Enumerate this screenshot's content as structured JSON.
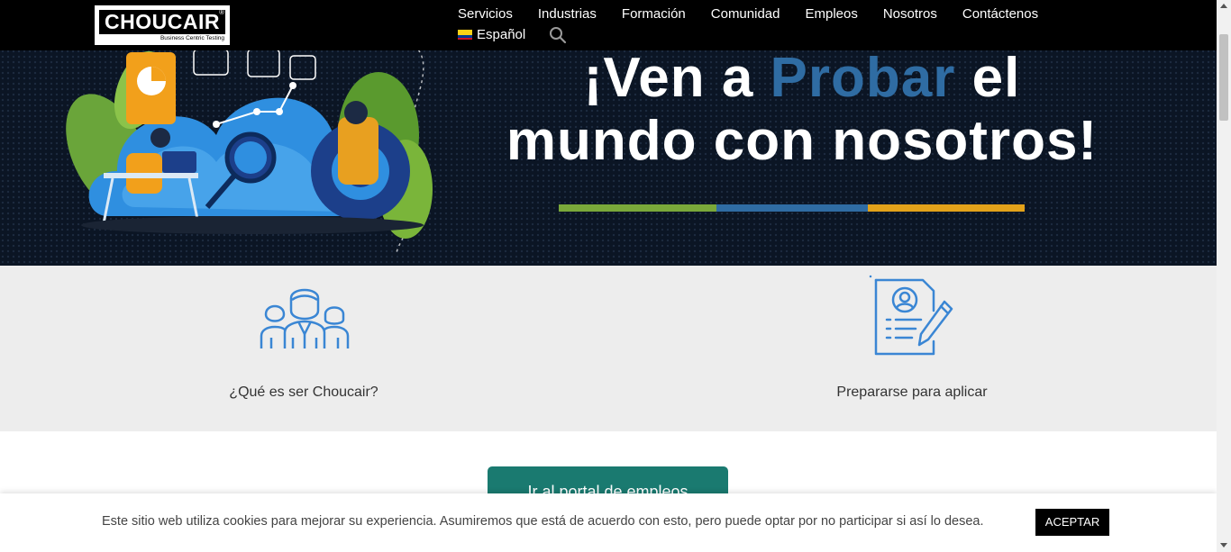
{
  "header": {
    "logo_text": "CHOUCAIR",
    "logo_tagline": "Business Centric Testing",
    "nav_items": [
      "Servicios",
      "Industrias",
      "Formación",
      "Comunidad",
      "Empleos",
      "Nosotros",
      "Contáctenos"
    ],
    "language": "Español",
    "search_icon": "search-icon"
  },
  "hero": {
    "title_part1": "¡Ven a ",
    "title_highlight": "Probar",
    "title_part2": " el",
    "title_line2": "mundo con nosotros!",
    "colors": {
      "background": "#0b1524",
      "highlight": "#2f6ca3",
      "bar_green": "#7aa83a",
      "bar_blue": "#2f6ca3",
      "bar_orange": "#e3a21a"
    }
  },
  "features": [
    {
      "label": "¿Qué es ser Choucair?",
      "icon": "team-icon"
    },
    {
      "label": "Prepararse para aplicar",
      "icon": "resume-document-icon"
    }
  ],
  "cta": {
    "label": "Ir al portal de empleos"
  },
  "cookie_bar": {
    "message": "Este sitio web utiliza cookies para mejorar su experiencia. Asumiremos que está de acuerdo con esto, pero puede optar por no participar si así lo desea.",
    "accept_label": "ACEPTAR"
  },
  "colors": {
    "icon_blue": "#3a86d4",
    "cta_teal": "#1a7a70"
  }
}
